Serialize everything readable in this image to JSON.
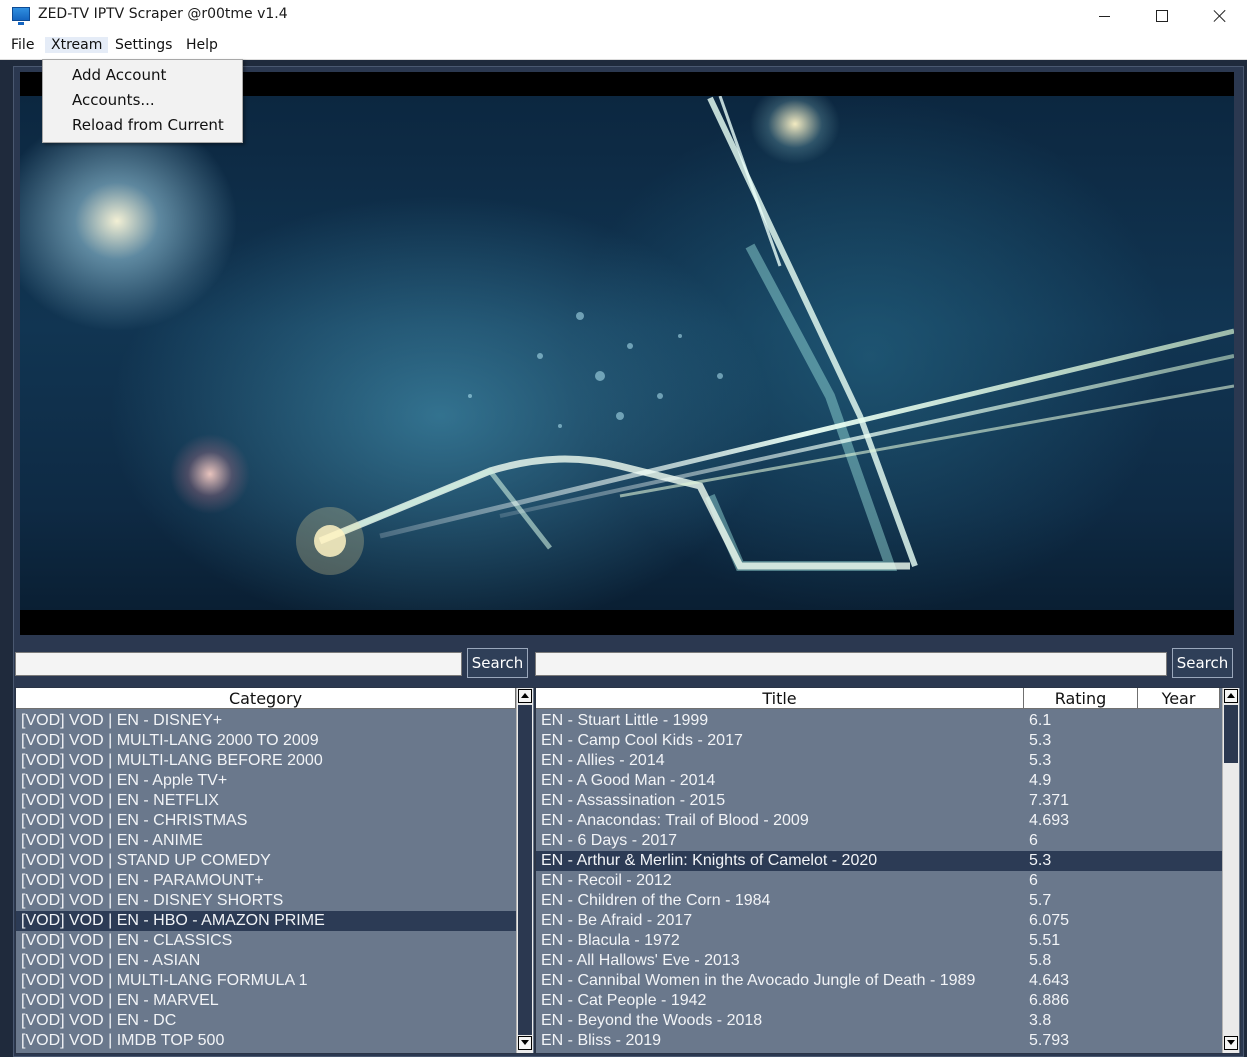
{
  "window": {
    "title": "ZED-TV IPTV Scraper @r00tme v1.4"
  },
  "menubar": {
    "items": [
      "File",
      "Xtream",
      "Settings",
      "Help"
    ]
  },
  "xtream_menu": {
    "items": [
      "Add Account",
      "Accounts...",
      "Reload from Current"
    ]
  },
  "category_search": {
    "value": "",
    "button_label": "Search"
  },
  "title_search": {
    "value": "",
    "button_label": "Search"
  },
  "category_list": {
    "header": "Category",
    "selected_index": 10,
    "items": [
      "[VOD] VOD | EN - DISNEY+",
      "[VOD] VOD | MULTI-LANG 2000 TO 2009",
      "[VOD] VOD | MULTI-LANG BEFORE 2000",
      "[VOD] VOD | EN - Apple TV+",
      "[VOD] VOD | EN - NETFLIX",
      "[VOD] VOD | EN - CHRISTMAS",
      "[VOD] VOD | EN - ANIME",
      "[VOD] VOD | STAND UP COMEDY",
      "[VOD] VOD | EN - PARAMOUNT+",
      "[VOD] VOD | EN - DISNEY SHORTS",
      "[VOD] VOD | EN - HBO - AMAZON PRIME",
      "[VOD] VOD | EN - CLASSICS",
      "[VOD] VOD | EN - ASIAN",
      "[VOD] VOD | MULTI-LANG FORMULA 1",
      "[VOD] VOD | EN - MARVEL",
      "[VOD] VOD | EN - DC",
      "[VOD] VOD | IMDB TOP 500"
    ]
  },
  "title_list": {
    "headers": [
      "Title",
      "Rating",
      "Year"
    ],
    "selected_index": 7,
    "rows": [
      {
        "title": "EN - Stuart Little - 1999",
        "rating": "6.1",
        "year": ""
      },
      {
        "title": "EN - Camp Cool Kids - 2017",
        "rating": "5.3",
        "year": ""
      },
      {
        "title": "EN - Allies - 2014",
        "rating": "5.3",
        "year": ""
      },
      {
        "title": "EN - A Good Man - 2014",
        "rating": "4.9",
        "year": ""
      },
      {
        "title": "EN - Assassination - 2015",
        "rating": "7.371",
        "year": ""
      },
      {
        "title": "EN - Anacondas: Trail of Blood - 2009",
        "rating": "4.693",
        "year": ""
      },
      {
        "title": "EN - 6 Days - 2017",
        "rating": "6",
        "year": ""
      },
      {
        "title": "EN - Arthur & Merlin: Knights of Camelot - 2020",
        "rating": "5.3",
        "year": ""
      },
      {
        "title": "EN - Recoil - 2012",
        "rating": "6",
        "year": ""
      },
      {
        "title": "EN - Children of the Corn - 1984",
        "rating": "5.7",
        "year": ""
      },
      {
        "title": "EN - Be Afraid - 2017",
        "rating": "6.075",
        "year": ""
      },
      {
        "title": "EN - Blacula - 1972",
        "rating": "5.51",
        "year": ""
      },
      {
        "title": "EN - All Hallows' Eve - 2013",
        "rating": "5.8",
        "year": ""
      },
      {
        "title": "EN - Cannibal Women in the Avocado Jungle of Death - 1989",
        "rating": "4.643",
        "year": ""
      },
      {
        "title": "EN - Cat People - 1942",
        "rating": "6.886",
        "year": ""
      },
      {
        "title": "EN - Beyond the Woods - 2018",
        "rating": "3.8",
        "year": ""
      },
      {
        "title": "EN - Bliss - 2019",
        "rating": "5.793",
        "year": ""
      }
    ]
  },
  "colors": {
    "list_background": "#6a788c",
    "selected_row": "#2c3b55",
    "panel_background": "#2b3850"
  },
  "icons": [
    "app-monitor-icon",
    "minimize-icon",
    "maximize-icon",
    "close-icon",
    "scroll-up-icon",
    "scroll-down-icon"
  ]
}
